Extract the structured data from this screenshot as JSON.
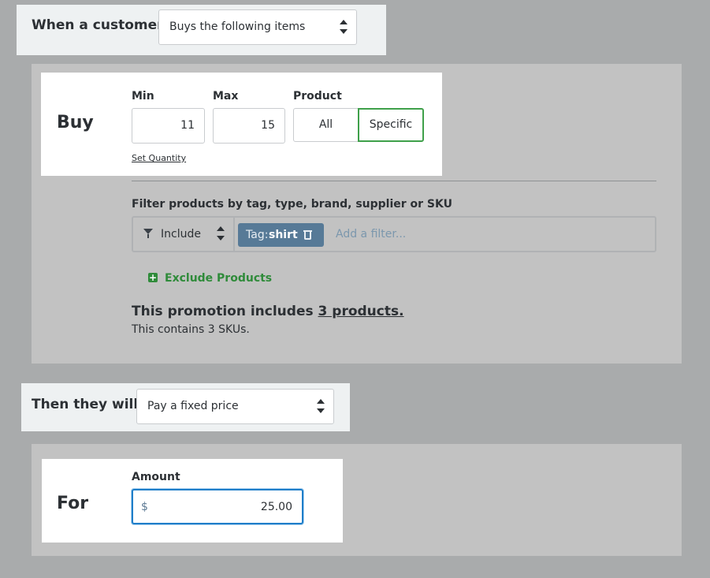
{
  "condition": {
    "label": "When a customer",
    "selected": "Buys the following items"
  },
  "buy": {
    "heading": "Buy",
    "min_label": "Min",
    "min_value": "11",
    "max_label": "Max",
    "max_value": "15",
    "product_label": "Product",
    "product_options": [
      "All",
      "Specific"
    ],
    "product_selected": "Specific",
    "set_quantity_link": "Set Quantity"
  },
  "filter": {
    "heading": "Filter products by tag, type, brand, supplier or SKU",
    "mode": "Include",
    "tag_prefix": "Tag:",
    "tag_value": "shirt",
    "placeholder": "Add a filter...",
    "exclude_label": "Exclude Products"
  },
  "summary": {
    "text_prefix": "This promotion includes",
    "products_link": "3 products.",
    "sku_text": "This contains 3 SKUs."
  },
  "action": {
    "label": "Then they will",
    "selected": "Pay a fixed price"
  },
  "for": {
    "heading": "For",
    "amount_label": "Amount",
    "currency_symbol": "$",
    "amount_value": "25.00"
  },
  "colors": {
    "page_bg": "#a9abac",
    "panel_bg": "#c2c2c2",
    "active_green": "#3fa04a",
    "tag_chip": "#577a97",
    "focus_blue": "#1f7ec9"
  },
  "icons": [
    "select-arrows-icon",
    "funnel-icon",
    "trash-icon",
    "plus-square-icon"
  ]
}
